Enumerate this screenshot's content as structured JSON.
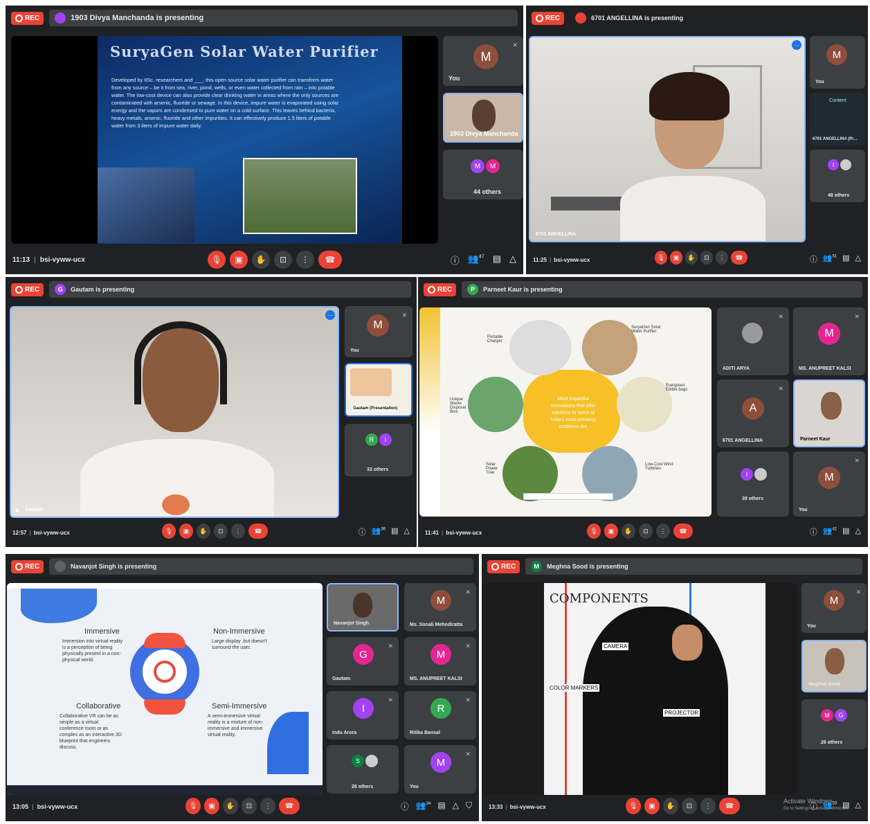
{
  "colors": {
    "panel": "#202124",
    "tile": "#3c4043",
    "rec": "#ea4335",
    "accent": "#8ab4f8"
  },
  "common": {
    "rec_label": "REC",
    "meeting_code": "bsi-vyww-ucx",
    "you_label": "You",
    "avatar_letter": "M"
  },
  "p1": {
    "presenting": "1903 Divya Manchanda is presenting",
    "time": "11:13",
    "count": "47",
    "slide": {
      "title": "SuryaGen Solar Water Purifier",
      "body": "Developed by IISc. researchers and ___, this open source solar water purifier can transform water from any source – be it from sea, river, pond, wells, or even water collected from rain – into potable water. The low-cost device can also provide clear drinking water in areas where the only sources are contaminated with arsenic, fluoride or sewage. In this device, impure water is evaporated using solar energy and the vapors are condensed to pure water on a cold surface. This leaves behind bacteria, heavy metals, arsenic, fluoride and other impurities. It can effectively produce 1.5 liters of potable water from 3 liters of impure water daily."
    },
    "tiles": [
      {
        "name": "You"
      },
      {
        "name": "1903 Divya Manchanda"
      },
      {
        "name": "44 others"
      }
    ]
  },
  "p2": {
    "presenting": "6701 ANGELLINA is presenting",
    "time": "11:25",
    "count": "51",
    "main_name": "6701 ANGELLINA",
    "content_label": "Content",
    "content_sub": "6701 ANGELLINA (Pr...",
    "others": "48 others"
  },
  "p3": {
    "presenting": "Gautam is presenting",
    "time": "12:57",
    "count": "36",
    "main_name": "Gautam",
    "pres_tile": "Gautam (Presentation)",
    "others": "33 others"
  },
  "p4": {
    "presenting": "Parneet Kaur is presenting",
    "time": "11:41",
    "count": "42",
    "slide": {
      "center": "Most impactful innovations that offer solutions to some of India's most pressing problems are",
      "items": [
        "Portable Charger",
        "SuryaGen Solar Water Purifier",
        "Evergreen Edible bags",
        "Low-Cost Wind Turbines",
        "Solar Power Tree",
        "Unique Waste Disposal Bins"
      ]
    },
    "tiles": [
      {
        "name": "ADITI ARYA"
      },
      {
        "name": "MS. ANUPREET KALSI"
      },
      {
        "name": "6701 ANGELLINA"
      },
      {
        "name": "Parneet Kaur"
      },
      {
        "name": "39 others"
      },
      {
        "name": "You"
      }
    ]
  },
  "p5": {
    "presenting": "Navanjot Singh is presenting",
    "time": "13:05",
    "count": "34",
    "slide": {
      "q1t": "Immersive",
      "q1b": "Immersion into virtual reality is a perception of being physically present in a non-physical world.",
      "q2t": "Non-Immersive",
      "q2b": "Large display ,but doesn't surround the user.",
      "q3t": "Collaborative",
      "q3b": "Collaborative VR can be as simple as a virtual conference room or as complex as an interactive 3D blueprint that engineers discuss.",
      "q4t": "Semi-Immersive",
      "q4b": "A semi-immersive virtual reality is a mixture of non-immersive and immersive virtual reality."
    },
    "tiles": [
      {
        "name": "Navanjot Singh"
      },
      {
        "name": "Ms. Sonali Mehndiratta"
      },
      {
        "name": "Gautam"
      },
      {
        "name": "MS. ANUPREET KALSI"
      },
      {
        "name": "Indu Arora"
      },
      {
        "name": "Ritika Bansal"
      },
      {
        "name": "26 others"
      },
      {
        "name": "You"
      }
    ]
  },
  "p6": {
    "presenting": "Meghna Sood is presenting",
    "time": "13:33",
    "count": "33",
    "slide": {
      "title": "COMPONENTS",
      "labels": [
        "CAMERA",
        "COLOR MARKERS",
        "PROJECTOR"
      ]
    },
    "tiles": [
      {
        "name": "You"
      },
      {
        "name": "Meghna Sood"
      },
      {
        "name": "26 others"
      }
    ],
    "watermark1": "Activate Windows",
    "watermark2": "Go to Settings to activate Windows."
  }
}
